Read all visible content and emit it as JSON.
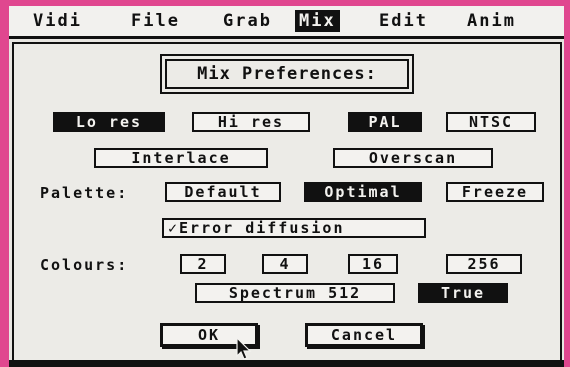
{
  "menubar": {
    "items": [
      "Vidi",
      "File",
      "Grab",
      "Mix",
      "Edit",
      "Anim"
    ],
    "active_index": 3
  },
  "dialog": {
    "title": "Mix Preferences:",
    "resolution": {
      "lo": "Lo res",
      "hi": "Hi res",
      "selected": "Lo res"
    },
    "standard": {
      "pal": "PAL",
      "ntsc": "NTSC",
      "selected": "PAL"
    },
    "interlace": "Interlace",
    "overscan": "Overscan",
    "palette": {
      "label": "Palette:",
      "default": "Default",
      "optimal": "Optimal",
      "freeze": "Freeze",
      "selected": "Optimal"
    },
    "error_diffusion": {
      "label": "✓Error diffusion",
      "checked": true
    },
    "colours": {
      "label": "Colours:",
      "options": [
        "2",
        "4",
        "16",
        "256"
      ],
      "spectrum": "Spectrum 512",
      "true_label": "True",
      "selected": "True"
    },
    "ok_label": "OK",
    "cancel_label": "Cancel"
  },
  "colors": {
    "frame": "#e0478f",
    "ink": "#111111",
    "paper": "#ecebe7"
  }
}
